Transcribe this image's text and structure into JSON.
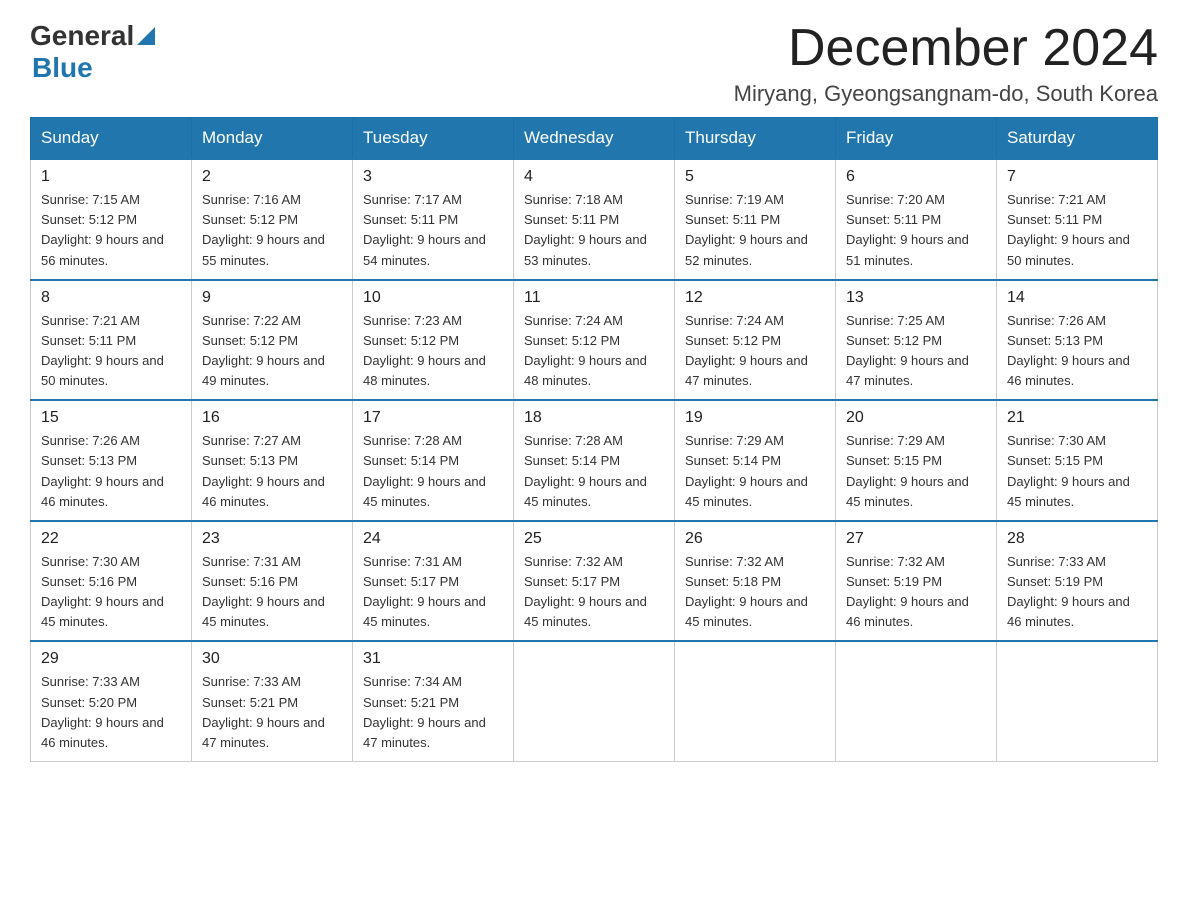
{
  "header": {
    "title": "December 2024",
    "subtitle": "Miryang, Gyeongsangnam-do, South Korea",
    "logo": {
      "general": "General",
      "blue": "Blue"
    }
  },
  "columns": [
    "Sunday",
    "Monday",
    "Tuesday",
    "Wednesday",
    "Thursday",
    "Friday",
    "Saturday"
  ],
  "weeks": [
    [
      {
        "day": "1",
        "sunrise": "Sunrise: 7:15 AM",
        "sunset": "Sunset: 5:12 PM",
        "daylight": "Daylight: 9 hours and 56 minutes."
      },
      {
        "day": "2",
        "sunrise": "Sunrise: 7:16 AM",
        "sunset": "Sunset: 5:12 PM",
        "daylight": "Daylight: 9 hours and 55 minutes."
      },
      {
        "day": "3",
        "sunrise": "Sunrise: 7:17 AM",
        "sunset": "Sunset: 5:11 PM",
        "daylight": "Daylight: 9 hours and 54 minutes."
      },
      {
        "day": "4",
        "sunrise": "Sunrise: 7:18 AM",
        "sunset": "Sunset: 5:11 PM",
        "daylight": "Daylight: 9 hours and 53 minutes."
      },
      {
        "day": "5",
        "sunrise": "Sunrise: 7:19 AM",
        "sunset": "Sunset: 5:11 PM",
        "daylight": "Daylight: 9 hours and 52 minutes."
      },
      {
        "day": "6",
        "sunrise": "Sunrise: 7:20 AM",
        "sunset": "Sunset: 5:11 PM",
        "daylight": "Daylight: 9 hours and 51 minutes."
      },
      {
        "day": "7",
        "sunrise": "Sunrise: 7:21 AM",
        "sunset": "Sunset: 5:11 PM",
        "daylight": "Daylight: 9 hours and 50 minutes."
      }
    ],
    [
      {
        "day": "8",
        "sunrise": "Sunrise: 7:21 AM",
        "sunset": "Sunset: 5:11 PM",
        "daylight": "Daylight: 9 hours and 50 minutes."
      },
      {
        "day": "9",
        "sunrise": "Sunrise: 7:22 AM",
        "sunset": "Sunset: 5:12 PM",
        "daylight": "Daylight: 9 hours and 49 minutes."
      },
      {
        "day": "10",
        "sunrise": "Sunrise: 7:23 AM",
        "sunset": "Sunset: 5:12 PM",
        "daylight": "Daylight: 9 hours and 48 minutes."
      },
      {
        "day": "11",
        "sunrise": "Sunrise: 7:24 AM",
        "sunset": "Sunset: 5:12 PM",
        "daylight": "Daylight: 9 hours and 48 minutes."
      },
      {
        "day": "12",
        "sunrise": "Sunrise: 7:24 AM",
        "sunset": "Sunset: 5:12 PM",
        "daylight": "Daylight: 9 hours and 47 minutes."
      },
      {
        "day": "13",
        "sunrise": "Sunrise: 7:25 AM",
        "sunset": "Sunset: 5:12 PM",
        "daylight": "Daylight: 9 hours and 47 minutes."
      },
      {
        "day": "14",
        "sunrise": "Sunrise: 7:26 AM",
        "sunset": "Sunset: 5:13 PM",
        "daylight": "Daylight: 9 hours and 46 minutes."
      }
    ],
    [
      {
        "day": "15",
        "sunrise": "Sunrise: 7:26 AM",
        "sunset": "Sunset: 5:13 PM",
        "daylight": "Daylight: 9 hours and 46 minutes."
      },
      {
        "day": "16",
        "sunrise": "Sunrise: 7:27 AM",
        "sunset": "Sunset: 5:13 PM",
        "daylight": "Daylight: 9 hours and 46 minutes."
      },
      {
        "day": "17",
        "sunrise": "Sunrise: 7:28 AM",
        "sunset": "Sunset: 5:14 PM",
        "daylight": "Daylight: 9 hours and 45 minutes."
      },
      {
        "day": "18",
        "sunrise": "Sunrise: 7:28 AM",
        "sunset": "Sunset: 5:14 PM",
        "daylight": "Daylight: 9 hours and 45 minutes."
      },
      {
        "day": "19",
        "sunrise": "Sunrise: 7:29 AM",
        "sunset": "Sunset: 5:14 PM",
        "daylight": "Daylight: 9 hours and 45 minutes."
      },
      {
        "day": "20",
        "sunrise": "Sunrise: 7:29 AM",
        "sunset": "Sunset: 5:15 PM",
        "daylight": "Daylight: 9 hours and 45 minutes."
      },
      {
        "day": "21",
        "sunrise": "Sunrise: 7:30 AM",
        "sunset": "Sunset: 5:15 PM",
        "daylight": "Daylight: 9 hours and 45 minutes."
      }
    ],
    [
      {
        "day": "22",
        "sunrise": "Sunrise: 7:30 AM",
        "sunset": "Sunset: 5:16 PM",
        "daylight": "Daylight: 9 hours and 45 minutes."
      },
      {
        "day": "23",
        "sunrise": "Sunrise: 7:31 AM",
        "sunset": "Sunset: 5:16 PM",
        "daylight": "Daylight: 9 hours and 45 minutes."
      },
      {
        "day": "24",
        "sunrise": "Sunrise: 7:31 AM",
        "sunset": "Sunset: 5:17 PM",
        "daylight": "Daylight: 9 hours and 45 minutes."
      },
      {
        "day": "25",
        "sunrise": "Sunrise: 7:32 AM",
        "sunset": "Sunset: 5:17 PM",
        "daylight": "Daylight: 9 hours and 45 minutes."
      },
      {
        "day": "26",
        "sunrise": "Sunrise: 7:32 AM",
        "sunset": "Sunset: 5:18 PM",
        "daylight": "Daylight: 9 hours and 45 minutes."
      },
      {
        "day": "27",
        "sunrise": "Sunrise: 7:32 AM",
        "sunset": "Sunset: 5:19 PM",
        "daylight": "Daylight: 9 hours and 46 minutes."
      },
      {
        "day": "28",
        "sunrise": "Sunrise: 7:33 AM",
        "sunset": "Sunset: 5:19 PM",
        "daylight": "Daylight: 9 hours and 46 minutes."
      }
    ],
    [
      {
        "day": "29",
        "sunrise": "Sunrise: 7:33 AM",
        "sunset": "Sunset: 5:20 PM",
        "daylight": "Daylight: 9 hours and 46 minutes."
      },
      {
        "day": "30",
        "sunrise": "Sunrise: 7:33 AM",
        "sunset": "Sunset: 5:21 PM",
        "daylight": "Daylight: 9 hours and 47 minutes."
      },
      {
        "day": "31",
        "sunrise": "Sunrise: 7:34 AM",
        "sunset": "Sunset: 5:21 PM",
        "daylight": "Daylight: 9 hours and 47 minutes."
      },
      null,
      null,
      null,
      null
    ]
  ]
}
